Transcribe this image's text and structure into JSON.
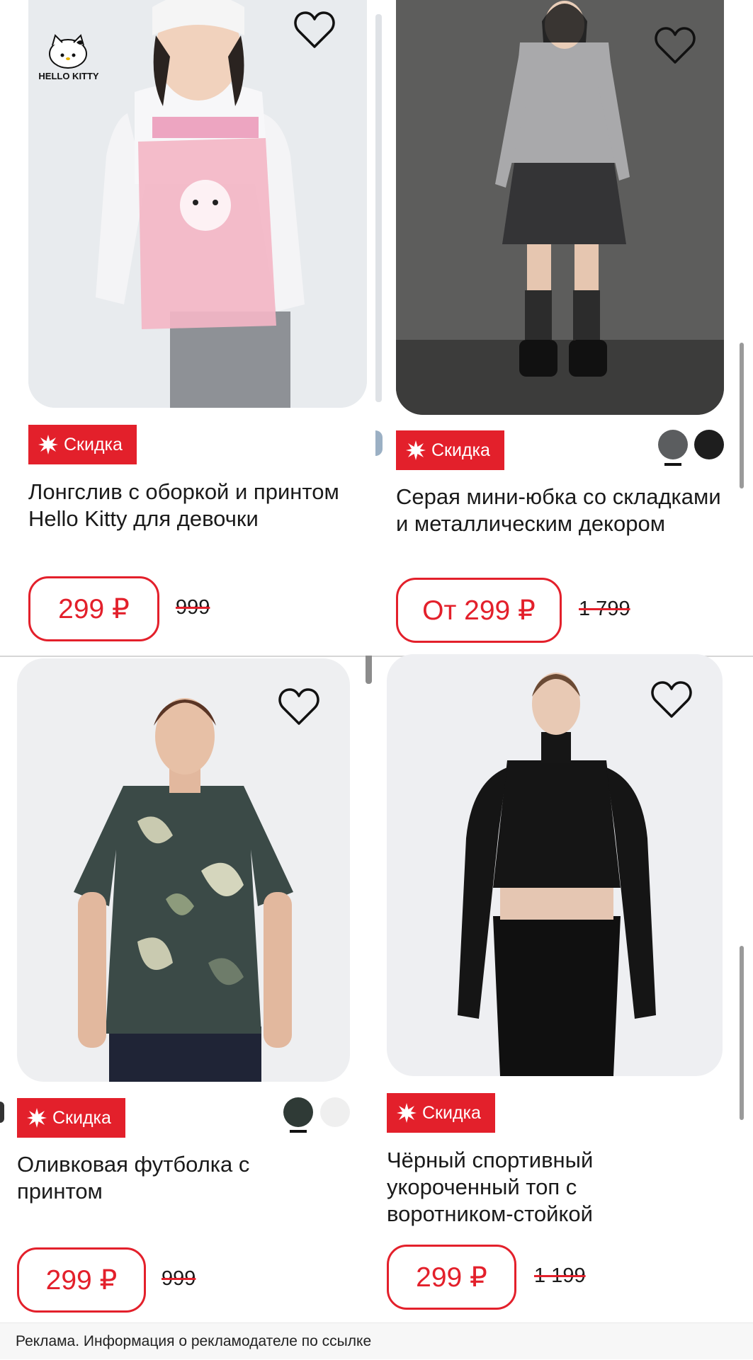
{
  "products": [
    {
      "title": "Лонгслив с оборкой и принтом Hello Kitty для девочки",
      "badge": "Скидка",
      "price": "299 ₽",
      "old_price": "999",
      "brand_logo": "HELLO KITTY",
      "swatches": []
    },
    {
      "title": "Серая мини-юбка со складками и металлическим декором",
      "badge": "Скидка",
      "price": "От 299 ₽",
      "old_price": "1 799",
      "swatches": [
        "#5b5d5f",
        "#1e1e1e"
      ]
    },
    {
      "title": "Оливковая футболка с принтом",
      "badge": "Скидка",
      "price": "299 ₽",
      "old_price": "999",
      "swatches": [
        "#2f3a36",
        "#efefef"
      ]
    },
    {
      "title": "Чёрный спортивный укороченный топ с воротником-стойкой",
      "badge": "Скидка",
      "price": "299 ₽",
      "old_price": "1 199",
      "swatches": []
    }
  ],
  "ad_notice": "Реклама. Информация о рекламодателе по ссылке",
  "colors": {
    "accent": "#e3202b",
    "text": "#1a1a1a"
  },
  "icons": {
    "favorite": "heart-outline-icon",
    "badge": "burst-star-icon"
  }
}
